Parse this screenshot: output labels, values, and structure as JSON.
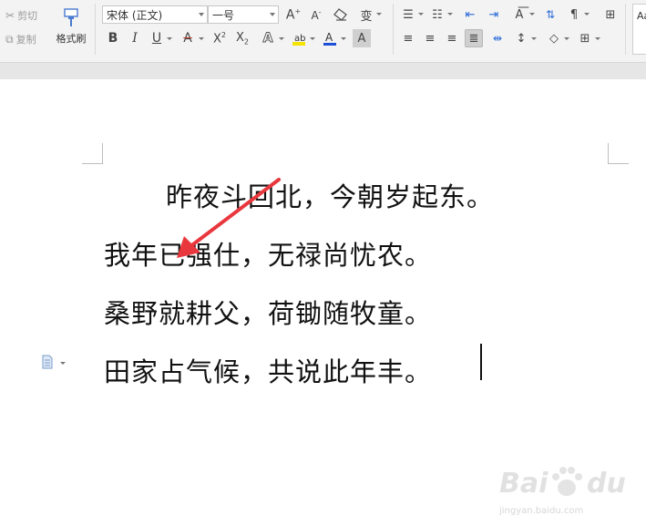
{
  "ribbon": {
    "cut_label": "剪切",
    "copy_label": "复制",
    "format_painter_label": "格式刷",
    "font_name": "宋体 (正文)",
    "font_size": "一号",
    "style_preview": "Aa"
  },
  "document": {
    "lines": [
      "昨夜斗回北，今朝岁起东。",
      "我年已强仕，无禄尚忧农。",
      "桑野就耕父，荷锄随牧童。",
      "田家占气候，共说此年丰。"
    ]
  },
  "watermark": {
    "brand": "Bai",
    "brand_suffix": "du",
    "sub": "jingyan.baidu.com"
  },
  "colors": {
    "annotation_arrow": "#e8383d",
    "font_color_underline": "#1e4fd8",
    "highlight_color": "#f5e400",
    "clear_format_red": "#d33"
  }
}
